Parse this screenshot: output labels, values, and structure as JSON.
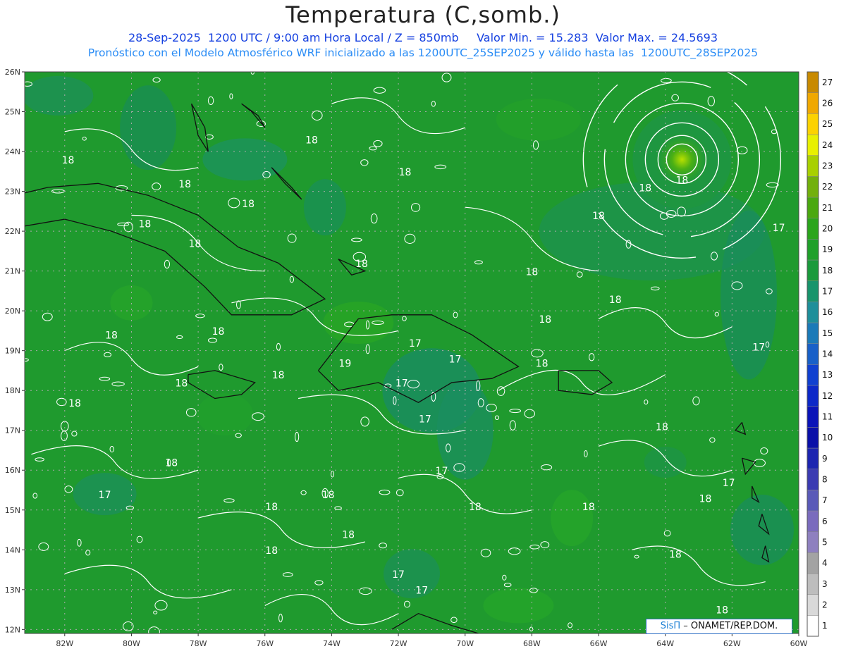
{
  "header": {
    "title": "Temperatura (C,somb.)",
    "line1": "28-Sep-2025  1200 UTC / 9:00 am Hora Local / Z = 850mb     Valor Min. = 15.283  Valor Max. = 24.5693",
    "line2": "Pronóstico con el Modelo Atmosférico WRF inicializado a las 1200UTC_25SEP2025 y válido hasta las  1200UTC_28SEP2025"
  },
  "map": {
    "lon_range": [
      -83.2,
      -60
    ],
    "lat_range": [
      11.9,
      26
    ],
    "lat_ticks": [
      "26N",
      "25N",
      "24N",
      "23N",
      "22N",
      "21N",
      "20N",
      "19N",
      "18N",
      "17N",
      "16N",
      "15N",
      "14N",
      "13N",
      "12N"
    ],
    "lon_ticks": [
      "82W",
      "80W",
      "78W",
      "76W",
      "74W",
      "72W",
      "70W",
      "68W",
      "66W",
      "64W",
      "62W",
      "60W"
    ],
    "background_color": "#1f9a2e",
    "cyclone_center": {
      "lon": -63.5,
      "lat": 23.8
    },
    "contour_labels": [
      {
        "text": "18",
        "lon": -81.9,
        "lat": 23.7
      },
      {
        "text": "18",
        "lon": -78.4,
        "lat": 23.1
      },
      {
        "text": "18",
        "lon": -74.6,
        "lat": 24.2
      },
      {
        "text": "18",
        "lon": -71.8,
        "lat": 23.4
      },
      {
        "text": "18",
        "lon": -76.5,
        "lat": 22.6
      },
      {
        "text": "18",
        "lon": -79.6,
        "lat": 22.1
      },
      {
        "text": "18",
        "lon": -78.1,
        "lat": 21.6
      },
      {
        "text": "18",
        "lon": -73.1,
        "lat": 21.1
      },
      {
        "text": "18",
        "lon": -64.6,
        "lat": 23.0
      },
      {
        "text": "18",
        "lon": -63.5,
        "lat": 23.2
      },
      {
        "text": "18",
        "lon": -66.0,
        "lat": 22.3
      },
      {
        "text": "18",
        "lon": -68.0,
        "lat": 20.9
      },
      {
        "text": "18",
        "lon": -65.5,
        "lat": 20.2
      },
      {
        "text": "18",
        "lon": -67.6,
        "lat": 19.7
      },
      {
        "text": "18",
        "lon": -80.6,
        "lat": 19.3
      },
      {
        "text": "18",
        "lon": -77.4,
        "lat": 19.4
      },
      {
        "text": "18",
        "lon": -75.6,
        "lat": 18.3
      },
      {
        "text": "18",
        "lon": -78.5,
        "lat": 18.1
      },
      {
        "text": "18",
        "lon": -81.7,
        "lat": 17.6
      },
      {
        "text": "18",
        "lon": -67.7,
        "lat": 18.6
      },
      {
        "text": "18",
        "lon": -64.1,
        "lat": 17.0
      },
      {
        "text": "18",
        "lon": -78.8,
        "lat": 16.1
      },
      {
        "text": "18",
        "lon": -74.1,
        "lat": 15.3
      },
      {
        "text": "18",
        "lon": -75.8,
        "lat": 15.0
      },
      {
        "text": "18",
        "lon": -69.7,
        "lat": 15.0
      },
      {
        "text": "18",
        "lon": -66.3,
        "lat": 15.0
      },
      {
        "text": "18",
        "lon": -62.8,
        "lat": 15.2
      },
      {
        "text": "18",
        "lon": -73.5,
        "lat": 14.3
      },
      {
        "text": "18",
        "lon": -75.8,
        "lat": 13.9
      },
      {
        "text": "18",
        "lon": -63.7,
        "lat": 13.8
      },
      {
        "text": "18",
        "lon": -62.3,
        "lat": 12.4
      },
      {
        "text": "19",
        "lon": -73.6,
        "lat": 18.6
      },
      {
        "text": "17",
        "lon": -71.5,
        "lat": 19.1
      },
      {
        "text": "17",
        "lon": -70.3,
        "lat": 18.7
      },
      {
        "text": "17",
        "lon": -71.9,
        "lat": 18.1
      },
      {
        "text": "17",
        "lon": -71.2,
        "lat": 17.2
      },
      {
        "text": "17",
        "lon": -70.7,
        "lat": 15.9
      },
      {
        "text": "17",
        "lon": -80.8,
        "lat": 15.3
      },
      {
        "text": "17",
        "lon": -72.0,
        "lat": 13.3
      },
      {
        "text": "17",
        "lon": -71.3,
        "lat": 12.9
      },
      {
        "text": "17",
        "lon": -61.2,
        "lat": 19.0
      },
      {
        "text": "17",
        "lon": -60.6,
        "lat": 22.0
      },
      {
        "text": "17",
        "lon": -62.1,
        "lat": 15.6
      }
    ]
  },
  "colorbar": {
    "labels": [
      "1",
      "2",
      "3",
      "4",
      "5",
      "6",
      "7",
      "8",
      "9",
      "10",
      "11",
      "12",
      "13",
      "14",
      "15",
      "16",
      "17",
      "18",
      "19",
      "20",
      "21",
      "22",
      "23",
      "24",
      "25",
      "26",
      "27"
    ],
    "colors": [
      "#ffffff",
      "#d9d9d9",
      "#bdbdbd",
      "#a3a3a3",
      "#8e80bf",
      "#7a6bbd",
      "#5a5ab8",
      "#3b3bb2",
      "#1c25b0",
      "#0a10a8",
      "#0a14b8",
      "#0c28c8",
      "#1040d0",
      "#1860c8",
      "#1a7ab8",
      "#1e8f9a",
      "#18946c",
      "#1a9a3c",
      "#1fa02a",
      "#2ba51c",
      "#4aa810",
      "#72b00c",
      "#a8d000",
      "#e8f000",
      "#fcd200",
      "#f0a800",
      "#c88a00"
    ]
  },
  "credit": {
    "brand": "SisΠ",
    "text": "– ONAMET/REP.DOM."
  }
}
